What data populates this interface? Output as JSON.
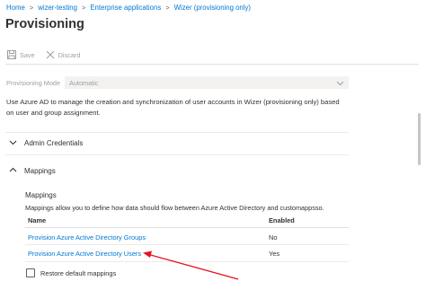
{
  "breadcrumb": {
    "items": [
      "Home",
      "wizer-testing",
      "Enterprise applications",
      "Wizer (provisioning only)"
    ],
    "separator": ">"
  },
  "page": {
    "title": "Provisioning"
  },
  "toolbar": {
    "save_label": "Save",
    "discard_label": "Discard"
  },
  "provisioning_mode": {
    "label": "Provisioning Mode",
    "value": "Automatic"
  },
  "description": "Use Azure AD to manage the creation and synchronization of user accounts in Wizer (provisioning only) based on user and group assignment.",
  "sections": {
    "admin_credentials": "Admin Credentials",
    "mappings": "Mappings"
  },
  "mappings": {
    "title": "Mappings",
    "description": "Mappings allow you to define how data should flow between Azure Active Directory and customappsso.",
    "columns": {
      "name": "Name",
      "enabled": "Enabled"
    },
    "rows": [
      {
        "name": "Provision Azure Active Directory Groups",
        "enabled": "No"
      },
      {
        "name": "Provision Azure Active Directory Users",
        "enabled": "Yes"
      }
    ],
    "restore_label": "Restore default mappings"
  },
  "colors": {
    "link": "#0078d4",
    "text": "#323130",
    "disabled": "#a19f9d",
    "annotation_arrow": "#e81123"
  },
  "icons": [
    "save-icon",
    "discard-icon",
    "chevron-down-icon",
    "chevron-up-icon",
    "chevron-right-icon"
  ]
}
